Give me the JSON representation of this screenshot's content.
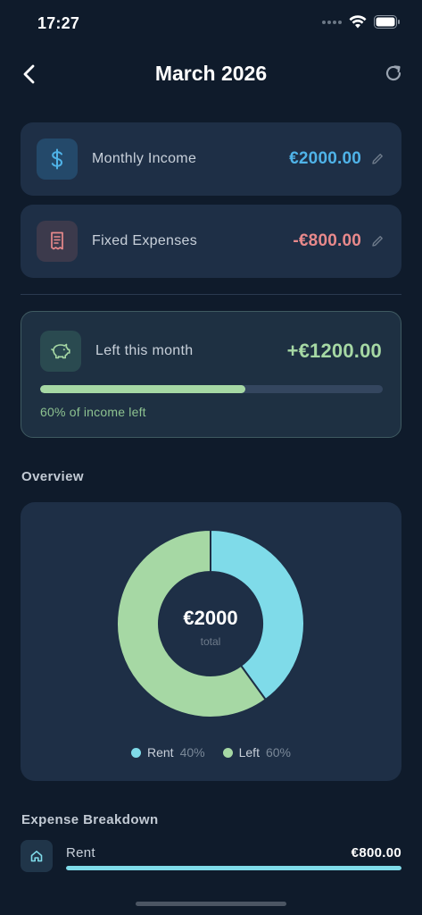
{
  "status_bar": {
    "time": "17:27"
  },
  "header": {
    "title": "March 2026"
  },
  "income": {
    "label": "Monthly Income",
    "value": "€2000.00",
    "icon": "dollar-icon",
    "color": "#4fb3e8"
  },
  "expenses": {
    "label": "Fixed Expenses",
    "value": "-€800.00",
    "icon": "receipt-icon",
    "color": "#e8898b"
  },
  "left": {
    "label": "Left this month",
    "value": "+€1200.00",
    "progress_fraction": 0.6,
    "caption": "60% of income left",
    "icon": "piggy-bank-icon",
    "color": "#a6d8a4"
  },
  "overview": {
    "title": "Overview"
  },
  "chart_data": {
    "type": "pie",
    "center_value": "€2000",
    "center_label": "total",
    "slices": [
      {
        "name": "Rent",
        "value": 40,
        "pct_label": "40%",
        "color": "#7fdbe9"
      },
      {
        "name": "Left",
        "value": 60,
        "pct_label": "60%",
        "color": "#a6d8a4"
      }
    ]
  },
  "breakdown": {
    "title": "Expense Breakdown",
    "items": [
      {
        "label": "Rent",
        "value": "€800.00",
        "fraction": 1.0,
        "icon": "home-icon",
        "color": "#7fdbe9"
      }
    ]
  }
}
